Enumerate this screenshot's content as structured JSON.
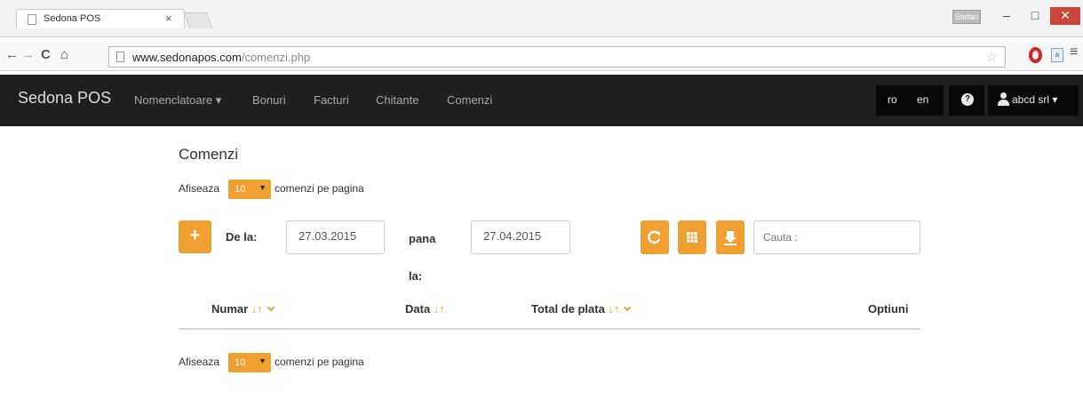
{
  "browser": {
    "tab_title": "Sedona POS",
    "tab_close": "×",
    "user_chip": "Stefan",
    "url_host": "www.sedonapos.com",
    "url_path": "/comenzi.php"
  },
  "navbar": {
    "brand": "Sedona POS",
    "links": [
      "Nomenclatoare ▾",
      "Bonuri",
      "Facturi",
      "Chitante",
      "Comenzi"
    ],
    "lang_ro": "ro",
    "lang_en": "en",
    "help": "?",
    "user": "abcd srl ▾"
  },
  "page": {
    "title": "Comenzi",
    "per_page_prefix": "Afiseaza",
    "per_page_value": "10",
    "per_page_suffix": "comenzi pe pagina",
    "add_glyph": "+",
    "from_label": "De la:",
    "from_date": "27.03.2015",
    "to_label_1": "pana",
    "to_label_2": "la:",
    "to_date": "27.04.2015",
    "search_placeholder": "Cauta :"
  },
  "table": {
    "columns": [
      "Numar",
      "Data",
      "Total de plata",
      "Optiuni"
    ]
  },
  "colors": {
    "accent": "#f0a030",
    "navbar_bg": "#1f1f1f"
  },
  "icons": [
    "refresh-icon",
    "grid-icon",
    "export-icon",
    "sort-icon",
    "chevron-down-icon",
    "user-icon",
    "question-icon"
  ]
}
